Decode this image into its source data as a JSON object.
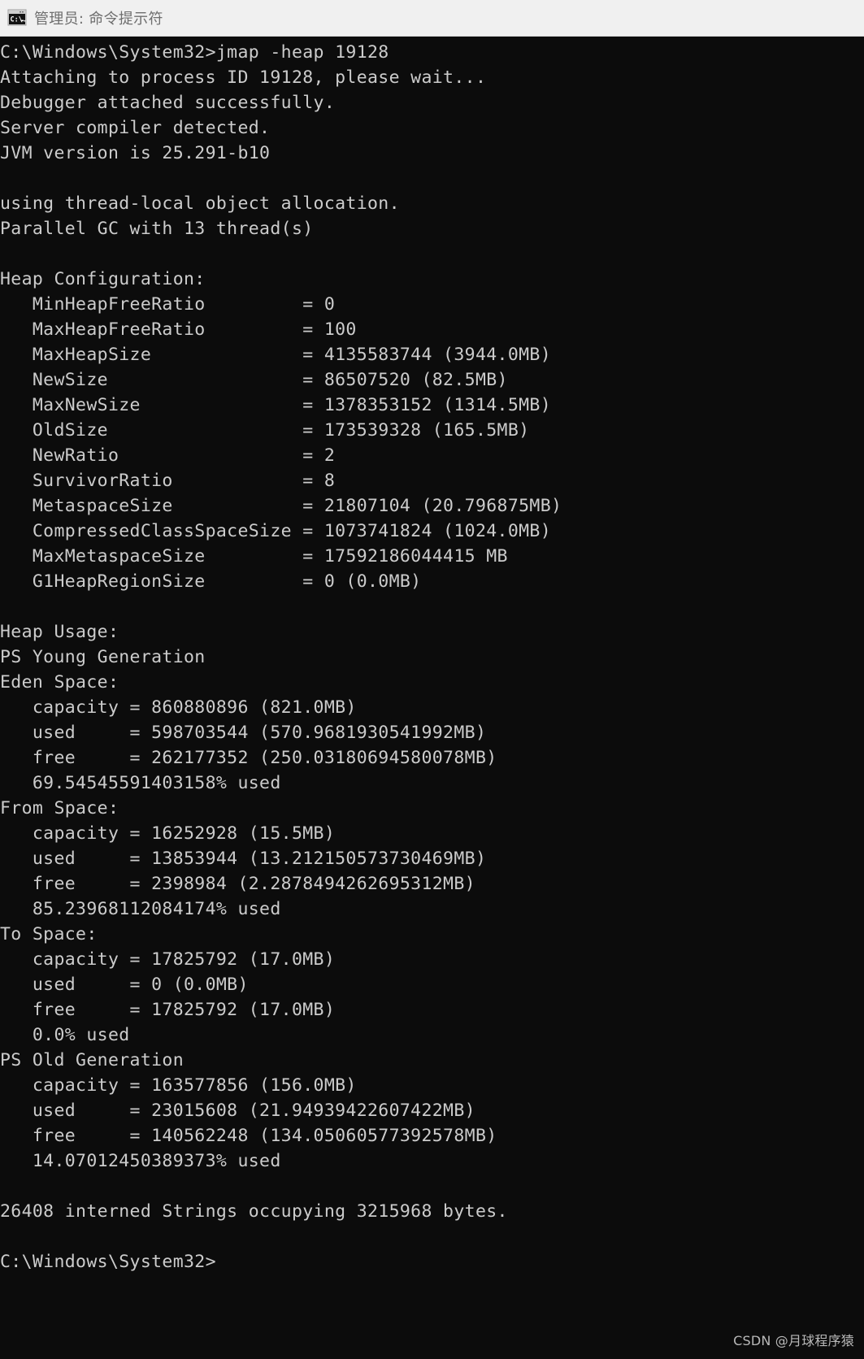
{
  "window": {
    "title": "管理员: 命令提示符",
    "icon": "command-prompt-icon",
    "background_color": "#0c0c0c",
    "titlebar_color": "#f0f0f0",
    "text_color": "#cccccc"
  },
  "watermark": {
    "text": "CSDN @月球程序猿"
  },
  "terminal": {
    "prompt_command": "C:\\Windows\\System32>jmap -heap 19128",
    "final_prompt": "C:\\Windows\\System32>",
    "lines": [
      "C:\\Windows\\System32>jmap -heap 19128",
      "Attaching to process ID 19128, please wait...",
      "Debugger attached successfully.",
      "Server compiler detected.",
      "JVM version is 25.291-b10",
      "",
      "using thread-local object allocation.",
      "Parallel GC with 13 thread(s)",
      "",
      "Heap Configuration:",
      "   MinHeapFreeRatio         = 0",
      "   MaxHeapFreeRatio         = 100",
      "   MaxHeapSize              = 4135583744 (3944.0MB)",
      "   NewSize                  = 86507520 (82.5MB)",
      "   MaxNewSize               = 1378353152 (1314.5MB)",
      "   OldSize                  = 173539328 (165.5MB)",
      "   NewRatio                 = 2",
      "   SurvivorRatio            = 8",
      "   MetaspaceSize            = 21807104 (20.796875MB)",
      "   CompressedClassSpaceSize = 1073741824 (1024.0MB)",
      "   MaxMetaspaceSize         = 17592186044415 MB",
      "   G1HeapRegionSize         = 0 (0.0MB)",
      "",
      "Heap Usage:",
      "PS Young Generation",
      "Eden Space:",
      "   capacity = 860880896 (821.0MB)",
      "   used     = 598703544 (570.9681930541992MB)",
      "   free     = 262177352 (250.03180694580078MB)",
      "   69.54545591403158% used",
      "From Space:",
      "   capacity = 16252928 (15.5MB)",
      "   used     = 13853944 (13.212150573730469MB)",
      "   free     = 2398984 (2.2878494262695312MB)",
      "   85.23968112084174% used",
      "To Space:",
      "   capacity = 17825792 (17.0MB)",
      "   used     = 0 (0.0MB)",
      "   free     = 17825792 (17.0MB)",
      "   0.0% used",
      "PS Old Generation",
      "   capacity = 163577856 (156.0MB)",
      "   used     = 23015608 (21.94939422607422MB)",
      "   free     = 140562248 (134.05060577392578MB)",
      "   14.07012450389373% used",
      "",
      "26408 interned Strings occupying 3215968 bytes.",
      "",
      "C:\\Windows\\System32>"
    ],
    "heap_configuration": {
      "MinHeapFreeRatio": "0",
      "MaxHeapFreeRatio": "100",
      "MaxHeapSize": "4135583744 (3944.0MB)",
      "NewSize": "86507520 (82.5MB)",
      "MaxNewSize": "1378353152 (1314.5MB)",
      "OldSize": "173539328 (165.5MB)",
      "NewRatio": "2",
      "SurvivorRatio": "8",
      "MetaspaceSize": "21807104 (20.796875MB)",
      "CompressedClassSpaceSize": "1073741824 (1024.0MB)",
      "MaxMetaspaceSize": "17592186044415 MB",
      "G1HeapRegionSize": "0 (0.0MB)"
    },
    "heap_usage": {
      "eden_space": {
        "capacity": "860880896 (821.0MB)",
        "used": "598703544 (570.9681930541992MB)",
        "free": "262177352 (250.03180694580078MB)",
        "percent_used": "69.54545591403158% used"
      },
      "from_space": {
        "capacity": "16252928 (15.5MB)",
        "used": "13853944 (13.212150573730469MB)",
        "free": "2398984 (2.2878494262695312MB)",
        "percent_used": "85.23968112084174% used"
      },
      "to_space": {
        "capacity": "17825792 (17.0MB)",
        "used": "0 (0.0MB)",
        "free": "17825792 (17.0MB)",
        "percent_used": "0.0% used"
      },
      "old_generation": {
        "capacity": "163577856 (156.0MB)",
        "used": "23015608 (21.94939422607422MB)",
        "free": "140562248 (134.05060577392578MB)",
        "percent_used": "14.07012450389373% used"
      }
    },
    "interned_strings": "26408 interned Strings occupying 3215968 bytes.",
    "jvm_version": "25.291-b10",
    "process_id": "19128",
    "gc_threads": "13"
  }
}
